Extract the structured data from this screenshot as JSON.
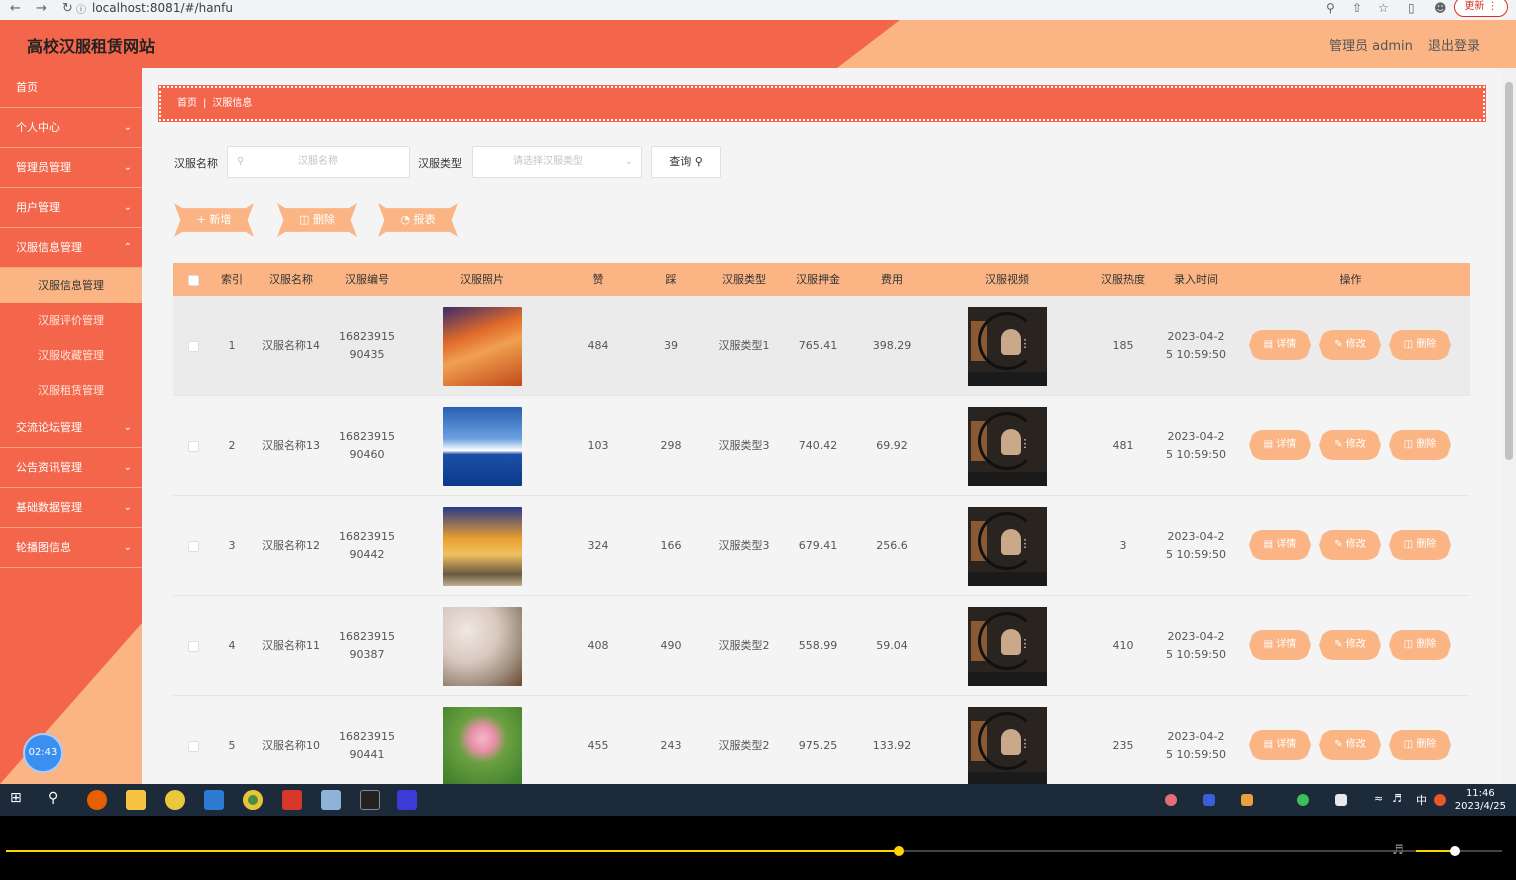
{
  "browser": {
    "url": "localhost:8081/#/hanfu",
    "update_label": "更新"
  },
  "header": {
    "title": "高校汉服租赁网站",
    "admin": "管理员 admin",
    "logout": "退出登录"
  },
  "sidebar": {
    "items": [
      {
        "label": "首页",
        "chevron": false
      },
      {
        "label": "个人中心",
        "chevron": true
      },
      {
        "label": "管理员管理",
        "chevron": true
      },
      {
        "label": "用户管理",
        "chevron": true
      },
      {
        "label": "汉服信息管理",
        "chevron": true
      }
    ],
    "subitems": [
      {
        "label": "汉服信息管理",
        "active": true
      },
      {
        "label": "汉服评价管理",
        "active": false
      },
      {
        "label": "汉服收藏管理",
        "active": false
      },
      {
        "label": "汉服租赁管理",
        "active": false
      }
    ],
    "items2": [
      {
        "label": "交流论坛管理"
      },
      {
        "label": "公告资讯管理"
      },
      {
        "label": "基础数据管理"
      },
      {
        "label": "轮播图信息"
      }
    ],
    "timer": "02:43"
  },
  "breadcrumb": {
    "home": "首页",
    "sep": "|",
    "current": "汉服信息"
  },
  "search": {
    "name_label": "汉服名称",
    "name_placeholder": "汉服名称",
    "type_label": "汉服类型",
    "type_placeholder": "请选择汉服类型",
    "query_label": "查询"
  },
  "actions": {
    "add": "新增",
    "delete": "删除",
    "report": "报表"
  },
  "table": {
    "headers": [
      "索引",
      "汉服名称",
      "汉服编号",
      "汉服照片",
      "赞",
      "踩",
      "汉服类型",
      "汉服押金",
      "费用",
      "汉服视频",
      "汉服热度",
      "录入时间",
      "操作"
    ],
    "rows": [
      {
        "index": "1",
        "name": "汉服名称14",
        "code_a": "16823915",
        "code_b": "90435",
        "photo": "mountain-sunset",
        "like": "484",
        "dislike": "39",
        "type": "汉服类型1",
        "deposit": "765.41",
        "fee": "398.29",
        "heat": "185",
        "time_a": "2023-04-2",
        "time_b": "5 10:59:50"
      },
      {
        "index": "2",
        "name": "汉服名称13",
        "code_a": "16823915",
        "code_b": "90460",
        "photo": "sea-sky",
        "like": "103",
        "dislike": "298",
        "type": "汉服类型3",
        "deposit": "740.42",
        "fee": "69.92",
        "heat": "481",
        "time_a": "2023-04-2",
        "time_b": "5 10:59:50"
      },
      {
        "index": "3",
        "name": "汉服名称12",
        "code_a": "16823915",
        "code_b": "90442",
        "photo": "beach-sunset",
        "like": "324",
        "dislike": "166",
        "type": "汉服类型3",
        "deposit": "679.41",
        "fee": "256.6",
        "heat": "3",
        "time_a": "2023-04-2",
        "time_b": "5 10:59:50"
      },
      {
        "index": "4",
        "name": "汉服名称11",
        "code_a": "16823915",
        "code_b": "90387",
        "photo": "blossom-branch",
        "like": "408",
        "dislike": "490",
        "type": "汉服类型2",
        "deposit": "558.99",
        "fee": "59.04",
        "heat": "410",
        "time_a": "2023-04-2",
        "time_b": "5 10:59:50"
      },
      {
        "index": "5",
        "name": "汉服名称10",
        "code_a": "16823915",
        "code_b": "90441",
        "photo": "lotus-flower",
        "like": "455",
        "dislike": "243",
        "type": "汉服类型2",
        "deposit": "975.25",
        "fee": "133.92",
        "heat": "235",
        "time_a": "2023-04-2",
        "time_b": "5 10:59:50"
      }
    ],
    "op_labels": {
      "detail": "详情",
      "edit": "修改",
      "delete": "删除"
    }
  },
  "colors": {
    "primary": "#f4664b",
    "secondary": "#fbb585",
    "accent_yellow": "#ffd400"
  },
  "taskbar": {
    "time": "11:46",
    "date": "2023/4/25",
    "ime": "中"
  },
  "player": {
    "progress_fraction": 0.597,
    "volume_fraction": 0.45
  }
}
